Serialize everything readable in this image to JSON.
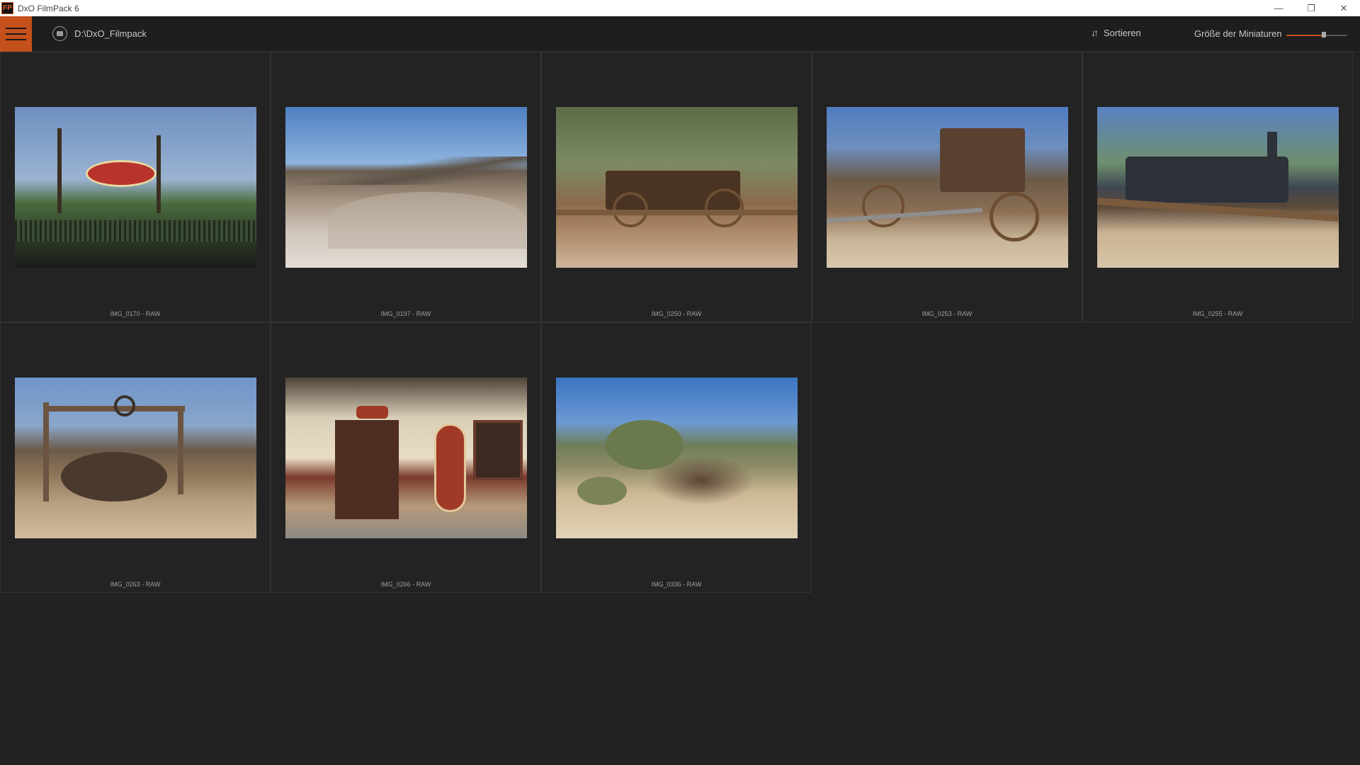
{
  "window": {
    "icon_text": "FP",
    "title": "DxO FilmPack 6",
    "controls": [
      "—",
      "❐",
      "✕"
    ]
  },
  "toolbar": {
    "path": "D:\\DxO_Filmpack",
    "sort_label": "Sortieren",
    "size_label": "Größe der Miniaturen",
    "thumbnail_size_level": 0.62
  },
  "colors": {
    "accent": "#c5501b",
    "background": "#222222"
  },
  "images": [
    {
      "label": "IMG_0170 - RAW",
      "subject": "las-vegas-sign"
    },
    {
      "label": "IMG_0197 - RAW",
      "subject": "desert-badlands"
    },
    {
      "label": "IMG_0250 - RAW",
      "subject": "old-wagon"
    },
    {
      "label": "IMG_0253 - RAW",
      "subject": "stagecoach"
    },
    {
      "label": "IMG_0255 - RAW",
      "subject": "steam-locomotive"
    },
    {
      "label": "IMG_0263 - RAW",
      "subject": "wooden-well"
    },
    {
      "label": "IMG_0266 - RAW",
      "subject": "general-store"
    },
    {
      "label": "IMG_0336 - RAW",
      "subject": "dead-tree-dune"
    }
  ]
}
